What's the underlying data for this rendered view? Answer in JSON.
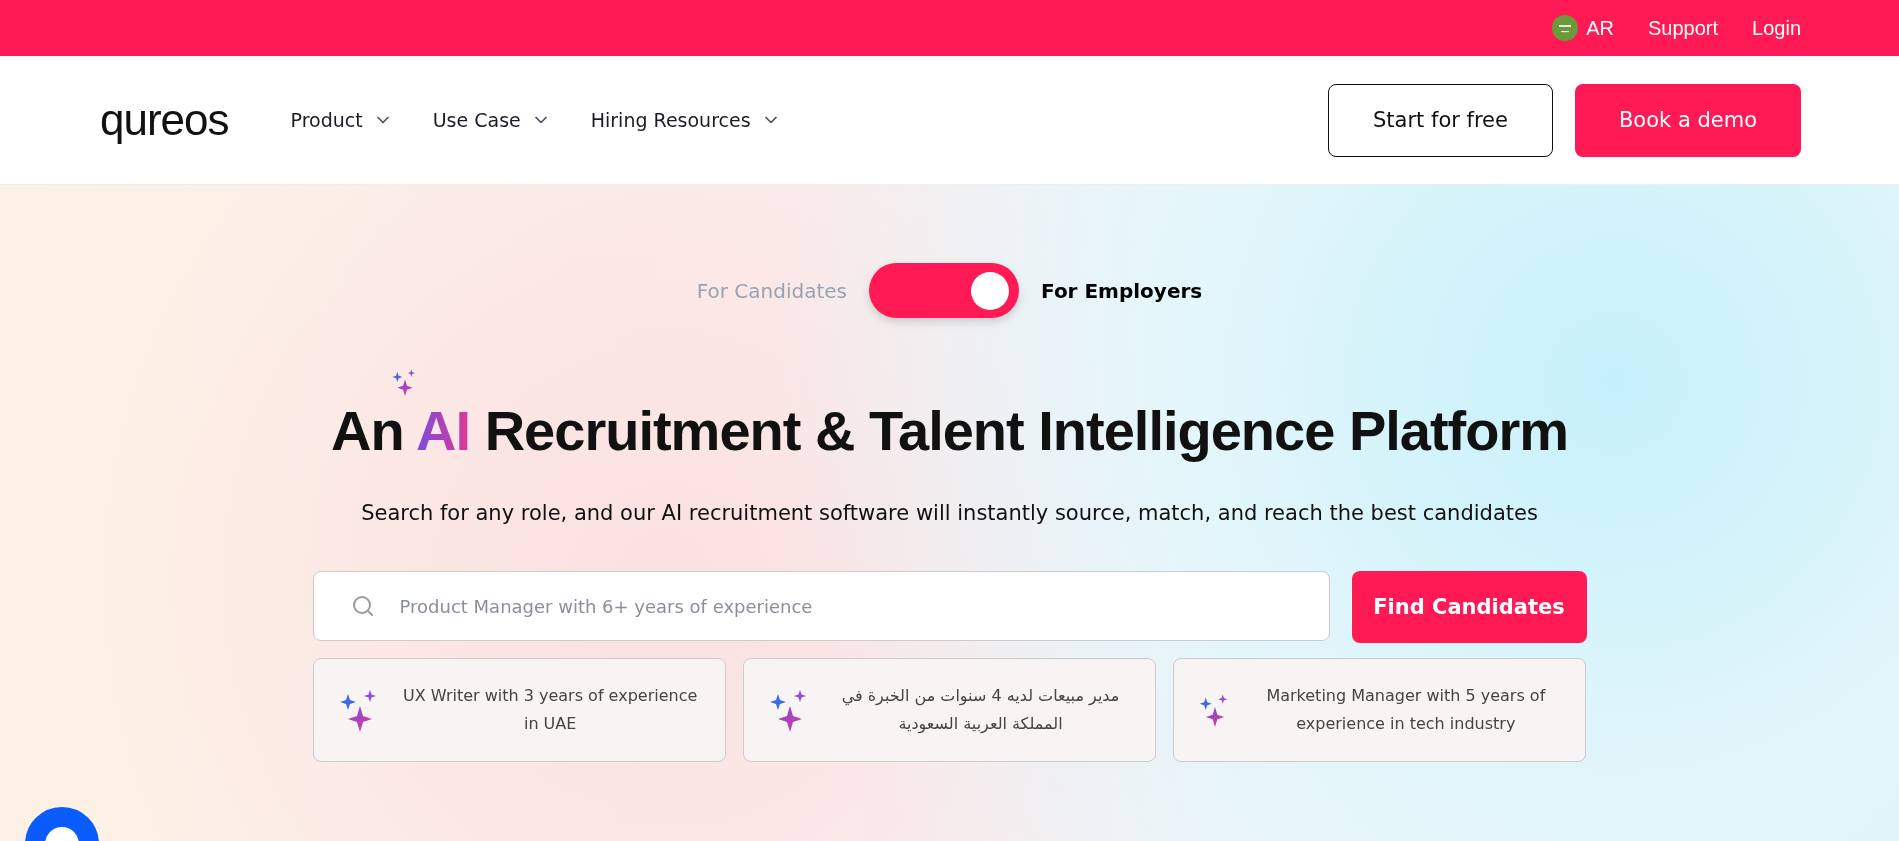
{
  "top_bar": {
    "language": "AR",
    "links": [
      "Support",
      "Login"
    ]
  },
  "header": {
    "logo": "qureos",
    "nav": [
      {
        "label": "Product"
      },
      {
        "label": "Use Case"
      },
      {
        "label": "Hiring Resources"
      }
    ],
    "buttons": [
      {
        "label": "Start for free",
        "kind": "outline"
      },
      {
        "label": "Book a demo",
        "kind": "primary"
      }
    ]
  },
  "audience_toggle": {
    "left_label": "For Candidates",
    "right_label": "For Employers",
    "on": true
  },
  "hero": {
    "title_before": "An",
    "title_highlight": "AI",
    "title_after": "Recruitment & Talent Intelligence Platform",
    "subtitle": "Search for any role, and our AI recruitment software will instantly source, match, and reach the best candidates"
  },
  "search": {
    "placeholder": "Product Manager with 6+ years of experience",
    "button": "Find Candidates"
  },
  "suggestions": [
    {
      "text": "UX Writer with 3 years of experience in UAE"
    },
    {
      "text": "مدير مبيعات لديه 4 سنوات من الخبرة في المملكة العربية السعودية"
    },
    {
      "text": "Marketing Manager with 5 years of experience in tech industry"
    }
  ]
}
